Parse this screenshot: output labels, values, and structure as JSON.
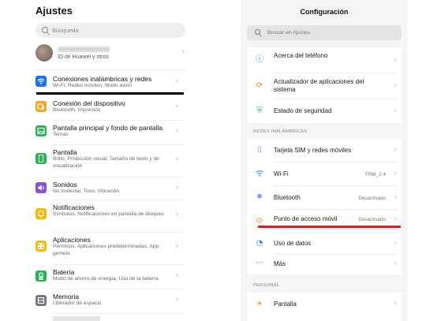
{
  "left": {
    "title": "Ajustes",
    "search_placeholder": "Búsqueda",
    "account": {
      "subtitle": "ID de Huawei y otros"
    },
    "items": [
      {
        "label": "Conexiones inalámbricas y redes",
        "sub": "Wi-Fi, Redes móviles, Modo avión",
        "icon": "wifi-icon",
        "color": "#1a73e8"
      },
      {
        "label": "Conexión del dispositivo",
        "sub": "Bluetooth, Impresión",
        "icon": "devices-icon",
        "color": "#f2a521"
      },
      {
        "label": "Pantalla principal y fondo de pantalla",
        "sub": "Temas",
        "icon": "image-icon",
        "color": "#23b552"
      },
      {
        "label": "Pantalla",
        "sub": "Brillo, Protección visual, Tamaño de texto y de visualización",
        "icon": "phone-icon",
        "color": "#26b84d"
      },
      {
        "label": "Sonidos",
        "sub": "No molestar, Tono, Vibración",
        "icon": "speaker-icon",
        "color": "#8a52d6"
      },
      {
        "label": "Notificaciones",
        "sub": "Símbolos, Notificaciones en pantalla de bloqueo",
        "icon": "bell-icon",
        "color": "#f5b90a"
      },
      {
        "label": "Aplicaciones",
        "sub": "Permisos, Aplicaciones predeterminadas, App gemela",
        "icon": "apps-icon",
        "color": "#f5b90a"
      },
      {
        "label": "Batería",
        "sub": "Modo de ahorro de energía, Uso de la batería",
        "icon": "battery-icon",
        "color": "#22b34f"
      },
      {
        "label": "Memoria",
        "sub": "Liberador de espacio",
        "icon": "storage-icon",
        "color": "#707a82"
      }
    ]
  },
  "right": {
    "title": "Configuración",
    "search_placeholder": "Buscar en Ajustes",
    "top_items": [
      {
        "label": "Acerca del teléfono",
        "icon": "info-icon",
        "color": "#2b7de9"
      },
      {
        "label": "Actualizador de aplicaciones del sistema",
        "icon": "update-icon",
        "color": "#f08a24"
      },
      {
        "label": "Estado de seguridad",
        "icon": "shield-icon",
        "color": "#2fa88a"
      }
    ],
    "section_wireless": "REDES INALÁMBRICAS",
    "wireless_items": [
      {
        "label": "Tarjeta SIM y redes móviles",
        "value": "",
        "icon": "sim-icon",
        "color": "#4a8be0"
      },
      {
        "label": "Wi-Fi",
        "value": "FRM_2.4",
        "icon": "wifi-icon",
        "color": "#2b9be0"
      },
      {
        "label": "Bluetooth",
        "value": "Desactivado",
        "icon": "bluetooth-icon",
        "color": "#7a8fe8"
      },
      {
        "label": "Punto de acceso móvil",
        "value": "Desactivado",
        "icon": "hotspot-icon",
        "color": "#f08a24"
      },
      {
        "label": "Uso de datos",
        "value": "",
        "icon": "data-usage-icon",
        "color": "#2b7de9"
      },
      {
        "label": "Más",
        "value": "",
        "icon": "more-icon",
        "color": "#2b7de9"
      }
    ],
    "section_personal": "PERSONAL",
    "personal_items": [
      {
        "label": "Pantalla",
        "value": "",
        "icon": "display-icon",
        "color": "#f08a24"
      }
    ]
  },
  "annotations": {
    "left_underline_color": "#000000",
    "right_underline_color": "#e01b1b"
  }
}
